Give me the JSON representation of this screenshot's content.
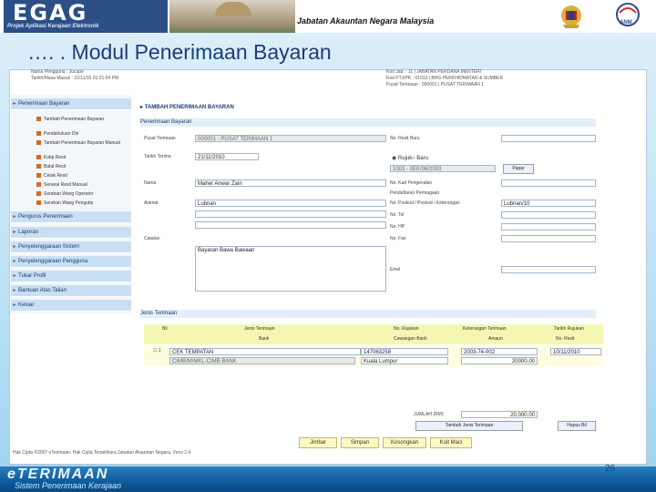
{
  "header": {
    "logo_text": "EGAG",
    "logo_subtitle": "Projek Aplikasi Kerajaan Elektronik",
    "agency": "Jabatan Akauntan Negara Malaysia",
    "anm": "ANM"
  },
  "slide": {
    "title": "…. . Modul Penerimaan Bayaran",
    "page_number": "26"
  },
  "session": {
    "left": [
      "Nama Pengguna : Jucupe",
      "Tarikh/Masa Masuk : 21/11/10  01:21:04 PM"
    ],
    "right": [
      "Kod Jab. : 11 | JABATAN PERDANA MENTERI",
      "Kod PTJ/PK : 01013 | BHG PERKHIDMATAN & SUMBER",
      "Pusat Terimaan : 000001 | PUSAT TERIMAAN 1"
    ]
  },
  "sidebar": {
    "items": [
      {
        "label": "Penerimaan Bayaran"
      },
      {
        "label": "Pengurus Penerimaan"
      },
      {
        "label": "Laporan"
      },
      {
        "label": "Penyelenggaraan Sistem"
      },
      {
        "label": "Penyelenggaraan Pengguna"
      },
      {
        "label": "Tukar Profil"
      },
      {
        "label": "Bantuan Atas Talian"
      },
      {
        "label": "Keluar"
      }
    ],
    "subitems": [
      "Tambah Penerimaan Bayaran",
      "Pendahuluan Diri",
      "Tambah Penerimaan Bayaran Manual",
      "Kutip Resit",
      "Batal Resit",
      "Cetak Resit",
      "Senarai Resit Manual",
      "Serahan Wang Operator",
      "Serahan Wang Pengutip"
    ]
  },
  "form": {
    "heading": "TAMBAH PENERIMAAN BAYARAN",
    "section1": "Penerimaan Bayaran",
    "pusat_label": "Pusat Terimaan",
    "pusat_value": "000001 - PUSAT TERIMAAN 1",
    "no_resit_label": "No. Resit Baru",
    "tarikh_label": "Tarikh Terima",
    "tarikh_value": "21/11/2010",
    "radio1": "Rujuk",
    "radio2": "Baru",
    "ref_value": "1003 - 0EK/06/2003",
    "carian_button": "Papar",
    "nama_label": "Nama",
    "nama_value": "Maher Anwar Zain",
    "no_kad_label": "No. Kad Pengenalan",
    "pendaftaran_label": "Pendaftaran Perniagaan",
    "alamat_label": "Alamat",
    "alamat_value": "Lubnan",
    "poskod_label": "No. Poskod / Poskod / Keterangan",
    "poskod_value": "Lubnan/10",
    "tel_label": "No. Tel",
    "hp_label": "No. HP",
    "fax_label": "No. Fax",
    "email_label": "Emel",
    "catatan_label": "Catatan",
    "catatan_value": "Bayaran  Bawa  Bawaan"
  },
  "table": {
    "section": "Jenis Terimaan",
    "head1": [
      "Bil",
      "Jenis Terimaan",
      "No. Rujukan",
      "Keterangan Terimaan",
      "Tarikh Rujukan"
    ],
    "head2": [
      "Bank",
      "Cawangan Bank",
      "Amaun",
      "No. Resit"
    ],
    "row1": {
      "bil": "1",
      "jenis": "CEK TEMPATAN",
      "rujukan": "147063258",
      "keterangan": "2003-74-002",
      "tarikh": "10/11/2010",
      "bank": "CIMB/M/MKL-CIMB BANK",
      "cawangan": "Kuala Lumpur",
      "amaun": "20000.00"
    },
    "jumlah_label": "JUMLAH (RM):",
    "jumlah_value": "20,000.00",
    "tambah_button": "Tambah Jenis Terimaan",
    "hapus_button": "Hapus Bil"
  },
  "actions": [
    "Jimbar",
    "Simpan",
    "Kosongkan",
    "Kuit Maci"
  ],
  "footer_note": "Hak Cipta ©2007 eTerimaan. Hak Cipta Terpelihara Jabatan Akauntan Negara. Versi 2.4.",
  "banner": {
    "title": "eTERIMAAN",
    "subtitle": "Sistem Penerimaan Kerajaan"
  }
}
